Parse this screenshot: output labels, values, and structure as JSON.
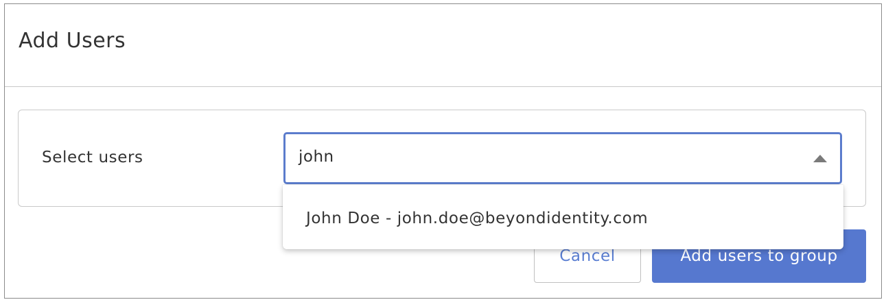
{
  "modal": {
    "title": "Add Users"
  },
  "field": {
    "label": "Select users",
    "value": "john",
    "caret_icon": "caret-up-icon"
  },
  "dropdown": {
    "options": [
      {
        "label": "John Doe - john.doe@beyondidentity.com"
      }
    ]
  },
  "actions": {
    "cancel_label": "Cancel",
    "submit_label": "Add users to group"
  },
  "colors": {
    "accent": "#5678cf",
    "focus_border": "#5b7ccc",
    "cancel_text": "#5a7ed2"
  }
}
